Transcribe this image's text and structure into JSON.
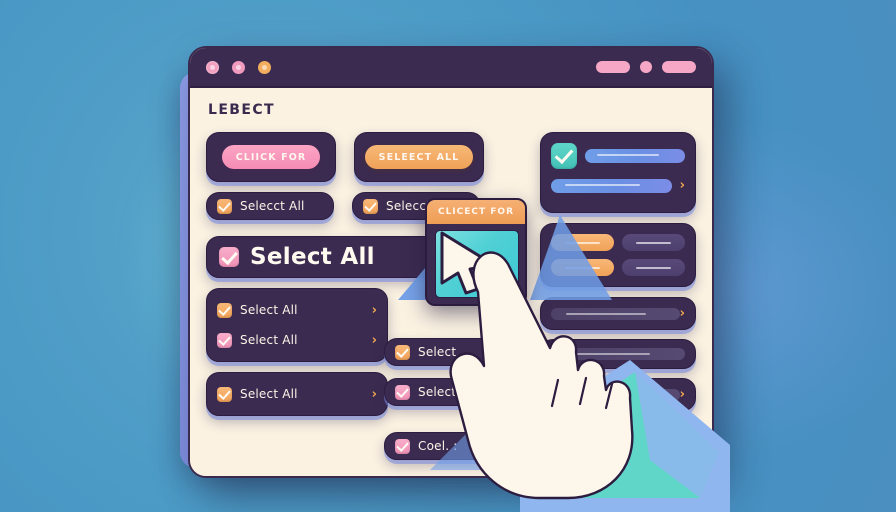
{
  "window": {
    "app_title": "LEBECT",
    "titlebar": {
      "dots": [
        "close-dot",
        "minimize-dot",
        "maximize-dot"
      ],
      "right_controls": [
        "pill",
        "dot",
        "pill"
      ]
    }
  },
  "buttons": [
    {
      "label": "CLIICK FOR",
      "color": "#f58cb4",
      "name": "click-for-button"
    },
    {
      "label": "SELEECT ALL",
      "color": "#f0a257",
      "name": "select-all-button"
    }
  ],
  "checkbox_rows_top": [
    {
      "label": "Selecct All",
      "checkbox": "orange",
      "checked": true
    },
    {
      "label": "Selecct All",
      "checkbox": "orange",
      "checked": true
    }
  ],
  "hero_row": {
    "label": "Select All",
    "checkbox": "pink",
    "checked": true
  },
  "left_group_a": [
    {
      "label": "Select All",
      "checkbox": "orange",
      "checked": true,
      "chevron": "›"
    },
    {
      "label": "Select All",
      "checkbox": "pink",
      "checked": true,
      "chevron": "›"
    }
  ],
  "left_group_b": [
    {
      "label": "Select All",
      "checkbox": "orange",
      "checked": true,
      "chevron": "›"
    }
  ],
  "middle_rows": [
    {
      "label": "Select",
      "checkbox": "orange",
      "checked": true,
      "chevron": "›"
    },
    {
      "label": "Select",
      "checkbox": "pink",
      "checked": true,
      "chevron": "›"
    },
    {
      "label": "Coel. :",
      "checkbox": "pink",
      "checked": true,
      "chevron": "›"
    }
  ],
  "right_panel": {
    "top_widget": {
      "checkbox": "teal",
      "checked": true,
      "bars": [
        "blue",
        "blue"
      ],
      "chevron": "›"
    },
    "pill_grid": [
      {
        "style": "orange"
      },
      {
        "style": "grey"
      },
      {
        "style": "orange"
      },
      {
        "style": "grey"
      }
    ],
    "list_rows": [
      {
        "bar": "grey",
        "chevron": "›"
      },
      {
        "bar": "grey",
        "chevron": ""
      },
      {
        "bar": "grey",
        "chevron": "›"
      }
    ]
  },
  "floating_card": {
    "label": "CLICECT FOR",
    "header_color": "#ee9d55",
    "screen_color": "#4fd0d4",
    "cursor": "arrow-pointer"
  },
  "colors": {
    "background": "#4a9ac4",
    "window_body": "#fbf2e2",
    "panel_dark": "#3c2b50",
    "accent_pink": "#f58cb4",
    "accent_orange": "#f0a257",
    "accent_teal": "#4fd0d4",
    "accent_blue": "#6f9ee8"
  }
}
